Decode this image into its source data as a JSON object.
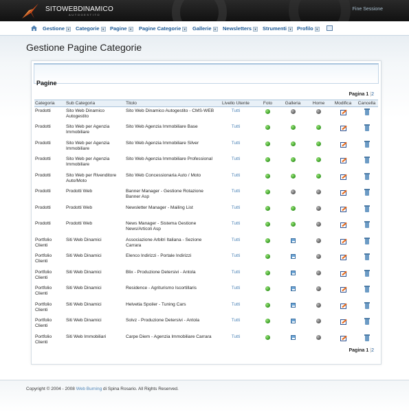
{
  "header": {
    "brand": "SITOWEBDINAMICO",
    "brand_sub": "AUTOGESTITO",
    "logout": "Fine Sessione"
  },
  "nav": {
    "items": [
      {
        "label": "Gestione"
      },
      {
        "label": "Categorie"
      },
      {
        "label": "Pagine"
      },
      {
        "label": "Pagine Categorie"
      },
      {
        "label": "Gallerie"
      },
      {
        "label": "Newsletters"
      },
      {
        "label": "Strumenti"
      },
      {
        "label": "Profilo"
      }
    ],
    "caret": "▼"
  },
  "page": {
    "title": "Gestione Pagine Categorie",
    "panel_title": "Pagine"
  },
  "pager": {
    "label": "Pagina",
    "current": "1",
    "sep": "|",
    "next": "2"
  },
  "table": {
    "headers": {
      "categoria": "Categoria",
      "sub": "Sub Categoria",
      "titolo": "Titolo",
      "livello": "Livello Utente",
      "foto": "Foto",
      "galleria": "Galleria",
      "home": "Home",
      "modifica": "Modifica",
      "cancella": "Cancella"
    },
    "rows": [
      {
        "categoria": "Prodotti",
        "sub": "Sito Web Dinamico Autogestito",
        "titolo": "Sito Web Dinamico Autogestito - CMS-WEB",
        "livello": "Tutti",
        "foto": "green",
        "galleria": "gray",
        "home": "gray"
      },
      {
        "categoria": "Prodotti",
        "sub": "Sito Web per Agenzia Immobiliare",
        "titolo": "Sito Web Agenzia Immobiliare Base",
        "livello": "Tutti",
        "foto": "green",
        "galleria": "green",
        "home": "green"
      },
      {
        "categoria": "Prodotti",
        "sub": "Sito Web per Agenzia Immobiliare",
        "titolo": "Sito Web Agenzia Immobiliare Silver",
        "livello": "Tutti",
        "foto": "green",
        "galleria": "green",
        "home": "green"
      },
      {
        "categoria": "Prodotti",
        "sub": "Sito Web per Agenzia Immobiliare",
        "titolo": "Sito Web Agenzia Immobiliare Professional",
        "livello": "Tutti",
        "foto": "green",
        "galleria": "green",
        "home": "green"
      },
      {
        "categoria": "Prodotti",
        "sub": "Sito Web per Rivenditore Auto/Moto",
        "titolo": "Sito Web Concessionaria Auto / Moto",
        "livello": "Tutti",
        "foto": "green",
        "galleria": "green",
        "home": "green"
      },
      {
        "categoria": "Prodotti",
        "sub": "Prodotti Web",
        "titolo": "Banner Manager - Gestione Rotazione Banner Asp",
        "livello": "Tutti",
        "foto": "green",
        "galleria": "gray",
        "home": "gray"
      },
      {
        "categoria": "Prodotti",
        "sub": "Prodotti Web",
        "titolo": "Newsletter Manager - Mailing List",
        "livello": "Tutti",
        "foto": "green",
        "galleria": "green",
        "home": "gray"
      },
      {
        "categoria": "Prodotti",
        "sub": "Prodotti Web",
        "titolo": "News Manager - Sistema Gestione News/Articoli Asp",
        "livello": "Tutti",
        "foto": "green",
        "galleria": "green",
        "home": "gray"
      },
      {
        "categoria": "Portfolio Clienti",
        "sub": "Siti Web Dinamici",
        "titolo": "Associazione Arbitri Italiana - Sezione Carrara",
        "livello": "Tutti",
        "foto": "green",
        "galleria": "icon",
        "home": "gray"
      },
      {
        "categoria": "Portfolio Clienti",
        "sub": "Siti Web Dinamici",
        "titolo": "Elenco Indirizzi - Portale Indirizzi",
        "livello": "Tutti",
        "foto": "green",
        "galleria": "icon",
        "home": "gray"
      },
      {
        "categoria": "Portfolio Clienti",
        "sub": "Siti Web Dinamici",
        "titolo": "Blix - Produzione Detersivi - Antola",
        "livello": "Tutti",
        "foto": "green",
        "galleria": "icon",
        "home": "gray"
      },
      {
        "categoria": "Portfolio Clienti",
        "sub": "Siti Web Dinamici",
        "titolo": "Residence - Agriturismo Iscortillaris",
        "livello": "Tutti",
        "foto": "green",
        "galleria": "icon",
        "home": "gray"
      },
      {
        "categoria": "Portfolio Clienti",
        "sub": "Siti Web Dinamici",
        "titolo": "Helvetia Spoiler - Tuning Cars",
        "livello": "Tutti",
        "foto": "green",
        "galleria": "icon",
        "home": "gray"
      },
      {
        "categoria": "Portfolio Clienti",
        "sub": "Siti Web Dinamici",
        "titolo": "Solvz - Produzione Detersivi - Antola",
        "livello": "Tutti",
        "foto": "green",
        "galleria": "icon",
        "home": "gray"
      },
      {
        "categoria": "Portfolio Clienti",
        "sub": "Siti Web Immobiliari",
        "titolo": "Carpe Diem - Agenzia Immobiliare Carrara",
        "livello": "Tutti",
        "foto": "green",
        "galleria": "icon",
        "home": "gray"
      }
    ]
  },
  "footer": {
    "prefix": "Copyright © 2004 - 2008",
    "link": "Web Burning",
    "suffix": "di Spina Rosario. All Rights Reserved."
  },
  "colors": {
    "nav_link": "#1d5a96",
    "link": "#4c83b6",
    "status_on": "#3fa32a",
    "status_off": "#666666"
  }
}
